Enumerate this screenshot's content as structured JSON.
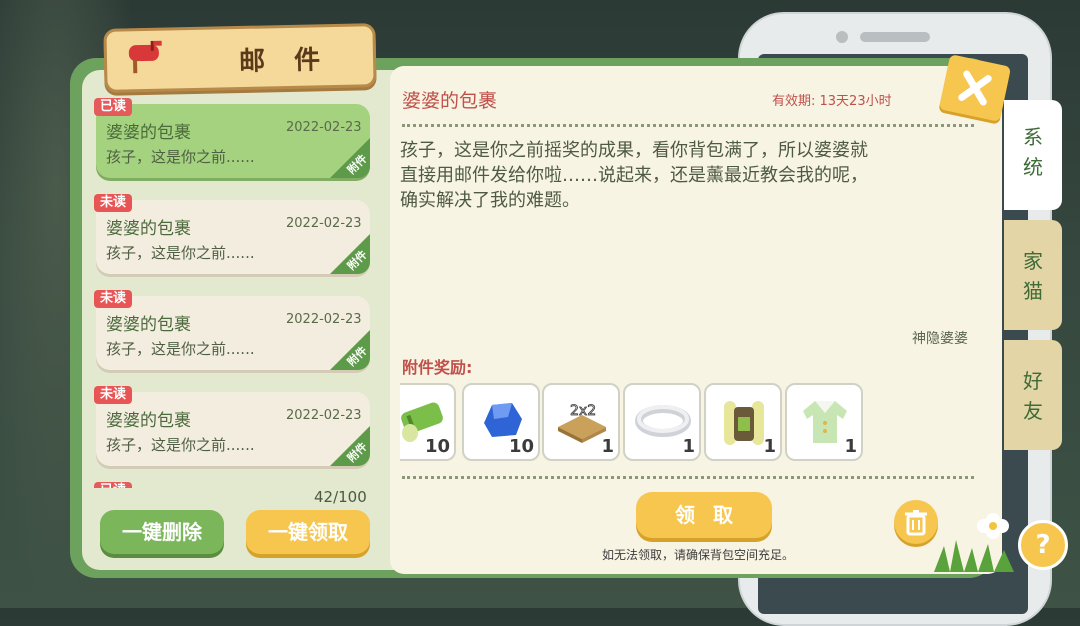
{
  "header": {
    "title": "邮 件"
  },
  "mails": [
    {
      "tag": "已读",
      "title": "婆婆的包裹",
      "date": "2022-02-23",
      "preview": "孩子，这是你之前......",
      "attach_label": "附件",
      "selected": true
    },
    {
      "tag": "未读",
      "title": "婆婆的包裹",
      "date": "2022-02-23",
      "preview": "孩子，这是你之前......",
      "attach_label": "附件",
      "selected": false
    },
    {
      "tag": "未读",
      "title": "婆婆的包裹",
      "date": "2022-02-23",
      "preview": "孩子，这是你之前......",
      "attach_label": "附件",
      "selected": false
    },
    {
      "tag": "未读",
      "title": "婆婆的包裹",
      "date": "2022-02-23",
      "preview": "孩子，这是你之前......",
      "attach_label": "附件",
      "selected": false
    },
    {
      "tag": "已读",
      "title": "",
      "date": "",
      "preview": "",
      "attach_label": "",
      "selected": false
    }
  ],
  "list_footer": {
    "count": "42/100",
    "delete_all": "一键删除",
    "claim_all": "一键领取"
  },
  "detail": {
    "title": "婆婆的包裹",
    "validity": "有效期: 13天23小时",
    "body": "孩子，这是你之前摇奖的成果，看你背包满了，所以婆婆就\n直接用邮件发给你啦……说起来，还是薰最近教会我的呢，\n确实解决了我的难题。",
    "sender": "神隐婆婆",
    "attach_heading": "附件奖励:",
    "items": [
      {
        "icon": "bamboo-icon",
        "qty": "10"
      },
      {
        "icon": "blue-stone-icon",
        "qty": "10"
      },
      {
        "icon": "floor-tile-2x2-icon",
        "qty": "1",
        "label": "2x2"
      },
      {
        "icon": "collar-ring-icon",
        "qty": "1"
      },
      {
        "icon": "backpack-icon",
        "qty": "1"
      },
      {
        "icon": "green-shirt-icon",
        "qty": "1"
      }
    ],
    "claim_button": "领取",
    "note": "如无法领取，请确保背包空间充足。"
  },
  "tabs": [
    {
      "label": "系统",
      "active": true
    },
    {
      "label": "家猫",
      "active": false
    },
    {
      "label": "好友",
      "active": false
    }
  ],
  "colors": {
    "panel_green": "#6da25e",
    "selected_green": "#a4d27f",
    "accent_yellow": "#f7c64e",
    "tag_red": "#e85555",
    "title_red": "#c0504a"
  }
}
